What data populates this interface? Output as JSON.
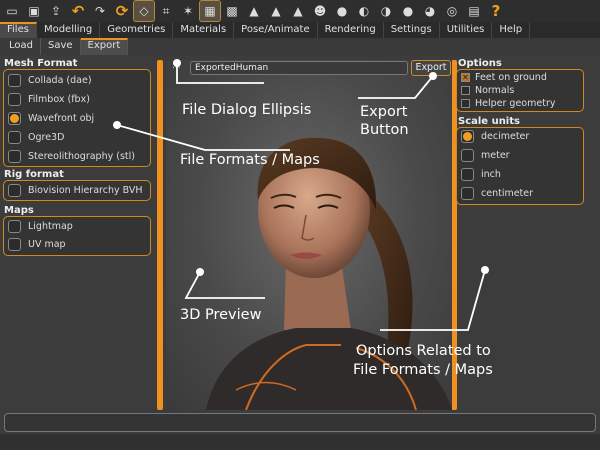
{
  "toolbar": {
    "icons": [
      "new-icon",
      "save-icon",
      "export-icon",
      "undo-icon",
      "redo-icon",
      "reset-icon",
      "smooth-icon",
      "wireframe-icon",
      "pose-icon",
      "grid-icon",
      "checker-icon",
      "front-view-icon",
      "back-view-icon",
      "left-view-icon",
      "right-view-icon",
      "top-view-icon",
      "bottom-view-icon",
      "reset-camera-icon",
      "screenshot-icon",
      "help-icon"
    ]
  },
  "main_tabs": [
    "Files",
    "Modelling",
    "Geometries",
    "Materials",
    "Pose/Animate",
    "Rendering",
    "Settings",
    "Utilities",
    "Help"
  ],
  "sub_tabs": [
    "Load",
    "Save",
    "Export"
  ],
  "mesh_format": {
    "title": "Mesh Format",
    "items": [
      "Collada (dae)",
      "Filmbox (fbx)",
      "Wavefront obj",
      "Ogre3D",
      "Stereolithography (stl)"
    ],
    "selected": "Wavefront obj"
  },
  "rig_format": {
    "title": "Rig format",
    "items": [
      "Biovision Hierarchy BVH"
    ]
  },
  "maps": {
    "title": "Maps",
    "items": [
      "Lightmap",
      "UV map"
    ]
  },
  "file_dialog": {
    "ellipsis": "...",
    "filename": "ExportedHuman",
    "export_label": "Export"
  },
  "options": {
    "title": "Options",
    "items": [
      {
        "label": "Feet on ground",
        "checked": true
      },
      {
        "label": "Normals",
        "checked": false
      },
      {
        "label": "Helper geometry",
        "checked": false
      }
    ]
  },
  "scale_units": {
    "title": "Scale units",
    "items": [
      "decimeter",
      "meter",
      "inch",
      "centimeter"
    ],
    "selected": "decimeter"
  },
  "annotations": {
    "file_dialog": "File Dialog Ellipsis",
    "export_button_1": "Export",
    "export_button_2": "Button",
    "file_formats": "File Formats / Maps",
    "preview": "3D Preview",
    "options_1": "Options Related to",
    "options_2": "File Formats / Maps"
  },
  "colors": {
    "accent": "#f09020",
    "panel": "#343434",
    "background": "#3c3c3c"
  }
}
